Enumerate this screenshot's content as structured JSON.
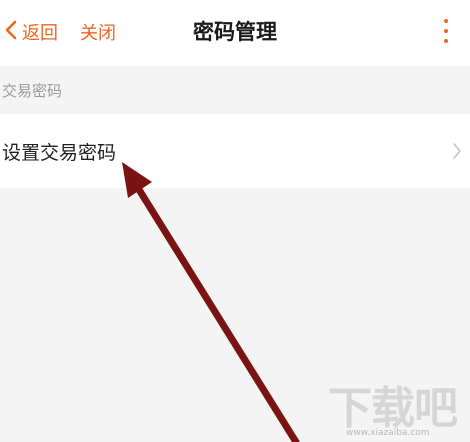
{
  "nav": {
    "back_label": "返回",
    "close_label": "关闭",
    "title": "密码管理"
  },
  "section": {
    "label": "交易密码"
  },
  "row": {
    "label": "设置交易密码"
  },
  "watermark": {
    "brand": "下载吧",
    "url": "www.xiazaiba.com"
  },
  "colors": {
    "accent": "#f0651f",
    "arrow": "#7a1414",
    "background": "#f4f4f4"
  },
  "icons": {
    "back": "chevron-left-icon",
    "more": "more-vertical-icon",
    "row_chevron": "chevron-right-icon"
  }
}
